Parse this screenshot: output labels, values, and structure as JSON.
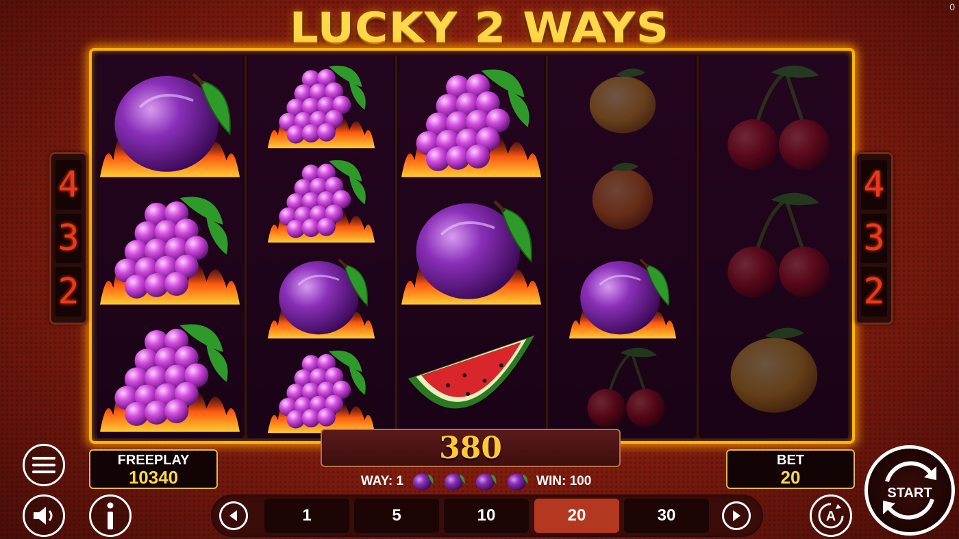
{
  "game": {
    "title": "LUCKY 2 WAYS",
    "corner_counter": "0"
  },
  "side_panels": {
    "left": [
      "4",
      "3",
      "2"
    ],
    "right": [
      "4",
      "3",
      "2"
    ]
  },
  "reels": [
    [
      "plum",
      "grapes",
      "grapes"
    ],
    [
      "grapes",
      "grapes",
      "plum",
      "grapes"
    ],
    [
      "grapes",
      "plum",
      "watermelon"
    ],
    [
      "lemon",
      "orange",
      "plum",
      "cherries"
    ],
    [
      "cherries",
      "cherries",
      "lemon"
    ]
  ],
  "win_amount": "380",
  "win_info": {
    "way_label": "WAY: 1",
    "symbol_icon": "plum-icon",
    "symbol_count": 4,
    "win_label": "WIN: 100"
  },
  "freeplay": {
    "label": "FREEPLAY",
    "value": "10340"
  },
  "bet": {
    "label": "BET",
    "value": "20"
  },
  "bet_options": [
    "1",
    "5",
    "10",
    "20",
    "30"
  ],
  "selected_bet": "20",
  "start_label": "START",
  "colors": {
    "frame_gold": "#ffb400",
    "win_gold": "#ffc935",
    "selected_bet": "#b4371f",
    "background_red": "#8a1f10"
  }
}
